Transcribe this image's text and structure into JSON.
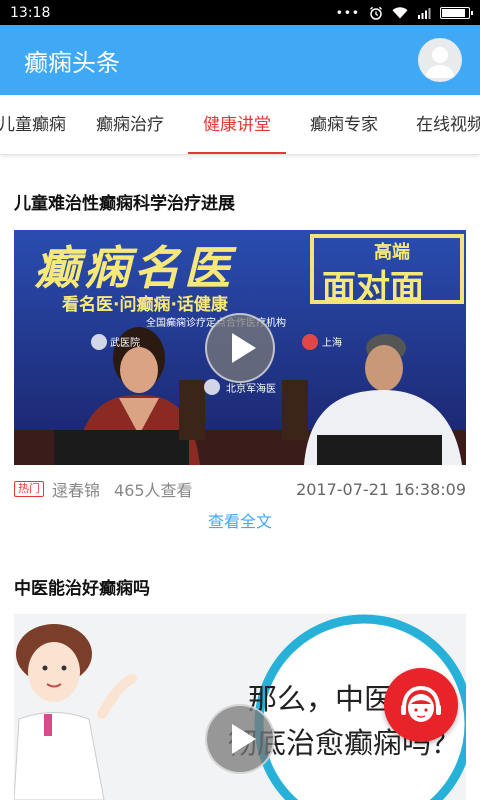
{
  "status": {
    "time": "13:18",
    "battery_level": 0.95
  },
  "appbar": {
    "title": "癫痫头条"
  },
  "tabs": [
    {
      "label": "儿童癫痫",
      "active": false
    },
    {
      "label": "癫痫治疗",
      "active": false
    },
    {
      "label": "健康讲堂",
      "active": true
    },
    {
      "label": "癫痫专家",
      "active": false
    },
    {
      "label": "在线视频",
      "active": false
    }
  ],
  "articles": [
    {
      "title": "儿童难治性癫痫科学治疗进展",
      "thumb": {
        "banner_big": "癫痫名医",
        "banner_side": "面对面",
        "banner_side_top": "高端",
        "subtitle": "看名医·问癫痫·话健康",
        "org_line": "全国癫痫诊疗定点合作医疗机构",
        "hospitals": [
          "武医院",
          "上海"
        ],
        "footer": "北京军海医"
      },
      "tag": "热门",
      "author": "逯春锦",
      "views": "465人查看",
      "date": "2017-07-21 16:38:09",
      "read_more": "查看全文"
    },
    {
      "title": "中医能治好癫痫吗",
      "thumb": {
        "line1": "那么，中医",
        "line2": "彻底治愈癫痫吗？"
      }
    }
  ],
  "colors": {
    "primary": "#3fa9f5",
    "accent": "#e53935",
    "fab": "#e8232a"
  }
}
